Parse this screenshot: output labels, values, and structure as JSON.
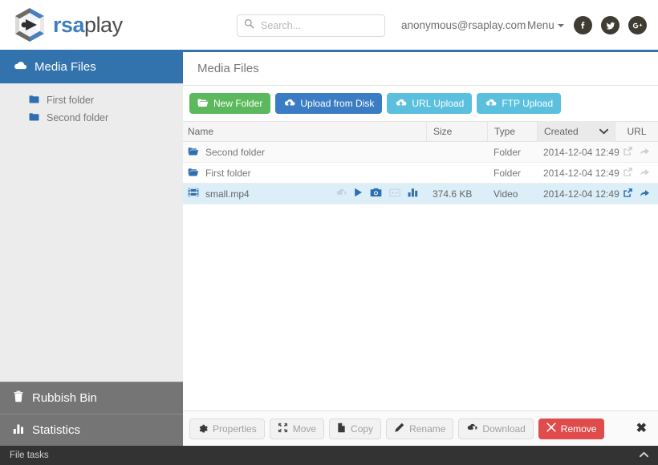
{
  "brand": {
    "name_primary": "rsa",
    "name_secondary": "play",
    "logo_icon": "hexagon-play-logo"
  },
  "header": {
    "search": {
      "placeholder": "Search...",
      "value": "",
      "icon": "search-icon"
    },
    "user_email": "anonymous@rsaplay.com",
    "menu_label": "Menu",
    "social": [
      {
        "name": "facebook-icon",
        "glyph": "f"
      },
      {
        "name": "twitter-icon",
        "glyph": "t"
      },
      {
        "name": "google-plus-icon",
        "glyph": "g+"
      }
    ]
  },
  "sidebar": {
    "header": {
      "label": "Media Files",
      "icon": "cloud-icon"
    },
    "tree": [
      {
        "label": "First folder",
        "icon": "folder-icon"
      },
      {
        "label": "Second folder",
        "icon": "folder-icon"
      }
    ],
    "bottom": [
      {
        "label": "Rubbish Bin",
        "icon": "trash-icon"
      },
      {
        "label": "Statistics",
        "icon": "bar-chart-icon"
      }
    ]
  },
  "content": {
    "title": "Media Files",
    "toolbar": [
      {
        "label": "New Folder",
        "icon": "folder-open-icon",
        "color": "#5cb85c"
      },
      {
        "label": "Upload from Disk",
        "icon": "cloud-upload-icon",
        "color": "#3b7dc4"
      },
      {
        "label": "URL Upload",
        "icon": "cloud-upload-icon",
        "color": "#5bc0de"
      },
      {
        "label": "FTP Upload",
        "icon": "cloud-upload-icon",
        "color": "#5bc0de"
      }
    ],
    "table": {
      "columns": [
        "Name",
        "Size",
        "Type",
        "Created",
        "URL"
      ],
      "sorted_column": "Created",
      "sort_direction": "desc",
      "rows": [
        {
          "name": "Second folder",
          "icon": "folder-icon",
          "size": "",
          "type": "Folder",
          "created": "2014-12-04 12:49",
          "selected": false,
          "has_media_actions": false,
          "url_enabled": false
        },
        {
          "name": "First folder",
          "icon": "folder-icon",
          "size": "",
          "type": "Folder",
          "created": "2014-12-04 12:49",
          "selected": false,
          "has_media_actions": false,
          "url_enabled": false
        },
        {
          "name": "small.mp4",
          "icon": "film-icon",
          "size": "374.6 KB",
          "type": "Video",
          "created": "2014-12-04 12:49",
          "selected": true,
          "has_media_actions": true,
          "url_enabled": true
        }
      ],
      "row_actions": [
        {
          "name": "cloud-download-icon",
          "enabled": false
        },
        {
          "name": "play-icon",
          "enabled": true
        },
        {
          "name": "camera-icon",
          "enabled": true
        },
        {
          "name": "closed-caption-icon",
          "enabled": false
        },
        {
          "name": "bar-chart-icon",
          "enabled": true
        }
      ],
      "url_actions": [
        {
          "name": "external-link-icon"
        },
        {
          "name": "share-arrow-icon"
        }
      ]
    },
    "actionbar": {
      "buttons": [
        {
          "label": "Properties",
          "icon": "gear-icon",
          "style": "default"
        },
        {
          "label": "Move",
          "icon": "arrows-move-icon",
          "style": "default"
        },
        {
          "label": "Copy",
          "icon": "file-icon",
          "style": "default"
        },
        {
          "label": "Rename",
          "icon": "pencil-icon",
          "style": "default"
        },
        {
          "label": "Download",
          "icon": "cloud-download-icon",
          "style": "default"
        },
        {
          "label": "Remove",
          "icon": "times-icon",
          "style": "danger"
        }
      ],
      "close_glyph": "✖"
    }
  },
  "footer": {
    "label": "File tasks",
    "collapse_icon": "chevron-up-icon"
  },
  "colors": {
    "brand_blue": "#3272ad",
    "green": "#5cb85c",
    "blue": "#3b7dc4",
    "cyan": "#5bc0de",
    "danger": "#e04b4b",
    "selected_row": "#dceff8",
    "sidebar_bg": "#ececec",
    "sidebar_bottom": "#757575",
    "footer_bg": "#333333"
  }
}
